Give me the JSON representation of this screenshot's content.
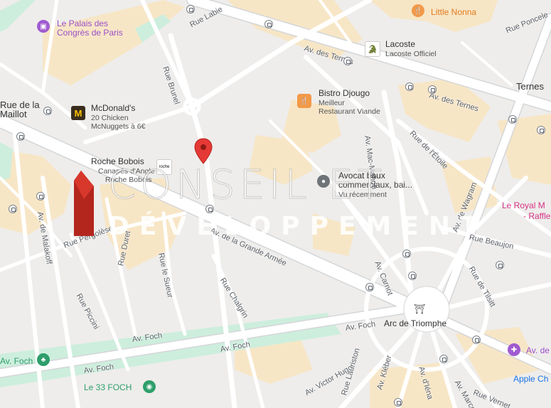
{
  "streets": {
    "rue_labie": "Rue Labie",
    "rue_brunel": "Rue Brunel",
    "av_ternes_1": "Av. des Ternes",
    "av_ternes_2": "Av. des Ternes",
    "rue_poncelet": "Rue Poncele",
    "rue_mac_mahon": "Av. Mac-Mahon",
    "rue_etoile": "Rue de l'Étoile",
    "av_wagram": "Av. de Wagram",
    "rue_beaujon": "Rue Beaujon",
    "rue_tilsitt": "Rue de Tilsitt",
    "grande_armee": "Av. de la Grande Armée",
    "av_carnot": "Av. Carnot",
    "rue_chalgrin": "Rue Chalgrin",
    "rue_duret": "Rue Duret",
    "rue_le_sueur": "Rue le Sueur",
    "rue_piccini": "Rue Piccini",
    "rue_pergolese": "Rue Pergolèse",
    "bd_malakoff": "Av. de Malakoff",
    "av_foch_1": "Av. Foch",
    "av_foch_2": "Av. Foch",
    "av_foch_3": "Av. Foch",
    "av_foch_4": "Av. Foch",
    "av_victor_hugo": "Av. Victor Hugo",
    "rue_lauriston": "Rue Lauriston",
    "rue_kleber": "Av. Kléber",
    "av_iena": "Av. d'Iéna",
    "av_marceau": "Av. Marcea",
    "rue_vernet": "Rue Vernet",
    "rue_bourbon": "Rue de la",
    "porte_maillot": "Maillot"
  },
  "pois": {
    "palais": {
      "title": "Le Palais des",
      "title2": "Congrès de Paris"
    },
    "mcdonalds": {
      "title": "McDonald's",
      "sub1": "20 Chicken",
      "sub2": "McNuggets à 6€"
    },
    "roche_bobois": {
      "title": "Roche Bobois",
      "sub1": "Canapés d'Angle",
      "sub2": "Roche Bobois"
    },
    "lacoste": {
      "title": "Lacoste",
      "sub1": "Lacoste Officiel"
    },
    "bistro": {
      "title": "Bistro Djougo",
      "sub1": "Meilleur",
      "sub2": "Restaurant Viande"
    },
    "little_nonna": {
      "title": "Little Nonna"
    },
    "avocat": {
      "title": "Avocat baux",
      "sub1": "commerciaux, bai...",
      "sub2": "Vu récemment"
    },
    "ternes": {
      "title": "Ternes"
    },
    "royal_monceau": {
      "title": "Le Royal M",
      "title2": "- Raffle"
    },
    "arc": {
      "title": "Arc de Triomphe"
    },
    "av_de": {
      "title": "Av. de"
    },
    "apple": {
      "title": "Apple Ch"
    },
    "le33": {
      "title": "Le 33 FOCH"
    },
    "foch_park": {
      "title": "Av. Foch"
    }
  },
  "watermark": {
    "line1": "CONSEIL ET",
    "line2": "DÉVELOPPEMENT"
  },
  "colors": {
    "road": "#ffffff",
    "road_edge": "#d5d6d8",
    "block": "#e9e8e6",
    "sand": "#f7e6c6",
    "park": "#cdeedd",
    "food": "#f2994a",
    "purple": "#a05bd0",
    "green": "#2e9e6b",
    "marker": "#e53935",
    "pink": "#d63384",
    "blue": "#1a73e8"
  }
}
